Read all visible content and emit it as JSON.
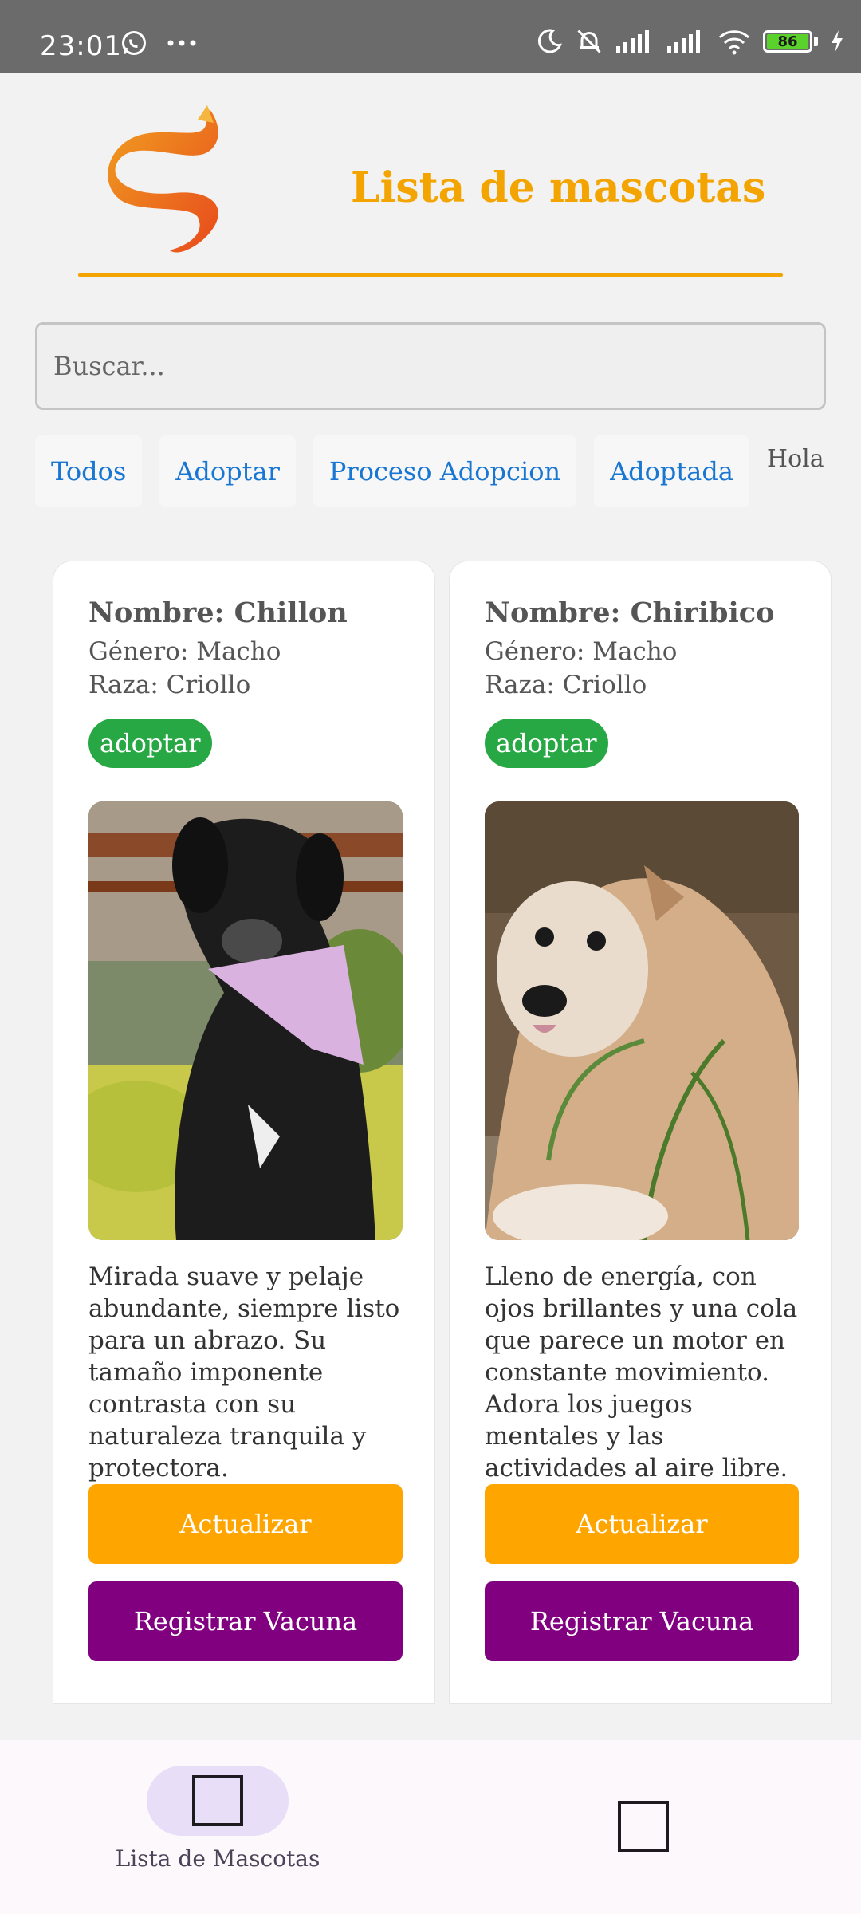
{
  "status_bar": {
    "time": "23:01",
    "battery": "86"
  },
  "header": {
    "title": "Lista de mascotas",
    "accent_color": "#f4a400"
  },
  "search": {
    "placeholder": "Buscar..."
  },
  "filters": {
    "chips": [
      "Todos",
      "Adoptar",
      "Proceso Adopcion",
      "Adoptada"
    ],
    "extra_text": "Hola"
  },
  "pets": [
    {
      "name": "Nombre: Chillon",
      "gender": "Género: Macho",
      "breed": "Raza: Criollo",
      "status": "adoptar",
      "description": "Mirada suave y pelaje abundante, siempre listo para un abrazo. Su tamaño imponente contrasta con su naturaleza tranquila y protectora.",
      "update_label": "Actualizar",
      "vaccine_label": "Registrar Vacuna"
    },
    {
      "name": "Nombre: Chiribico",
      "gender": "Género: Macho",
      "breed": "Raza: Criollo",
      "status": "adoptar",
      "description": "Lleno de energía, con ojos brillantes y una cola que parece un motor en constante movimiento. Adora los juegos mentales y las actividades al aire libre.",
      "update_label": "Actualizar",
      "vaccine_label": "Registrar Vacuna"
    }
  ],
  "bottom_nav": {
    "items": [
      {
        "label": "Lista de Mascotas",
        "icon": "square-outline-icon",
        "active": true
      },
      {
        "label": "",
        "icon": "square-outline-icon",
        "active": false
      }
    ]
  },
  "colors": {
    "status_badge": "#27a844",
    "update_button": "#ffa500",
    "vaccine_button": "#800080",
    "filter_text": "#1976d2"
  }
}
